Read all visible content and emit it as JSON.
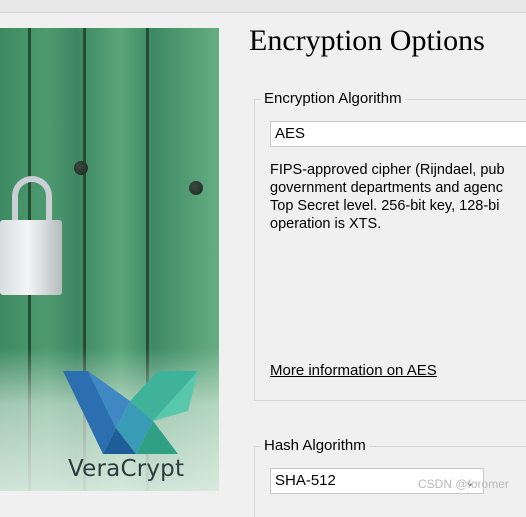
{
  "page_title": "Encryption Options",
  "encryption_algorithm": {
    "group_label": "Encryption Algorithm",
    "selected": "AES",
    "description_lines": [
      "FIPS-approved cipher (Rijndael, pub",
      "government departments and agenc",
      "Top Secret level. 256-bit key, 128-bi",
      "operation is XTS."
    ],
    "more_info_link": "More information on AES"
  },
  "hash_algorithm": {
    "group_label": "Hash Algorithm",
    "selected": "SHA-512"
  },
  "branding": {
    "product_name": "VeraCrypt"
  },
  "watermark": "CSDN @foromer",
  "colors": {
    "background": "#f0f0f0",
    "panel_green": "#3e8b63",
    "logo_blue": "#2c6fb0",
    "logo_teal": "#3fb39a"
  }
}
